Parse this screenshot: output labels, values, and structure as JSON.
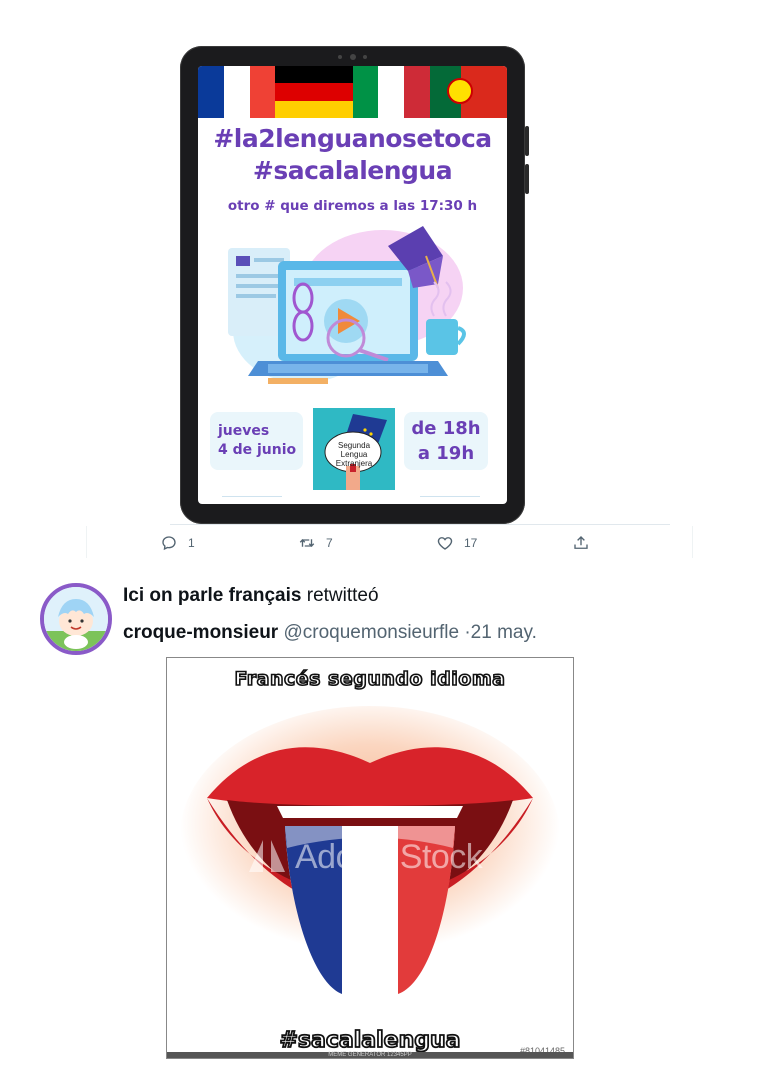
{
  "tablet_post": {
    "flags": [
      "fr",
      "de",
      "it",
      "pt"
    ],
    "hashtag_1": "#la2lenguanosetoca",
    "hashtag_2": "#sacalalengua",
    "subline": "otro # que diremos a las 17:30 h",
    "day_line1": "jueves",
    "day_line2": "4 de junio",
    "time_line1": "de 18h",
    "time_line2": "a 19h",
    "logo_text_1": "Segunda",
    "logo_text_2": "Lengua",
    "logo_text_3": "Extranjera"
  },
  "actions": {
    "reply_icon": "reply-icon",
    "reply_count": "1",
    "retweet_icon": "retweet-icon",
    "retweet_count": "7",
    "like_icon": "heart-icon",
    "like_count": "17",
    "share_icon": "share-icon"
  },
  "retweet_header": {
    "retweeter": "Ici on parle français",
    "action": "retwitteó"
  },
  "tweet": {
    "author_name": "croque-monsieur",
    "author_handle": "@croquemonsieurfle",
    "date": "·21 may.",
    "image": {
      "title_text": "Francés segundo idioma",
      "bottom_text": "#sacalalengua",
      "watermark": "Adobe Stock",
      "stock_id": "#81041485",
      "generator_text": "MEME GENERATOR 12345PP"
    }
  },
  "colors": {
    "purple": "#6a3fb5",
    "avatar_ring": "#8a5ac8",
    "muted": "#536471",
    "lip_red": "#d8232a",
    "flag_blue": "#1f3a93"
  }
}
